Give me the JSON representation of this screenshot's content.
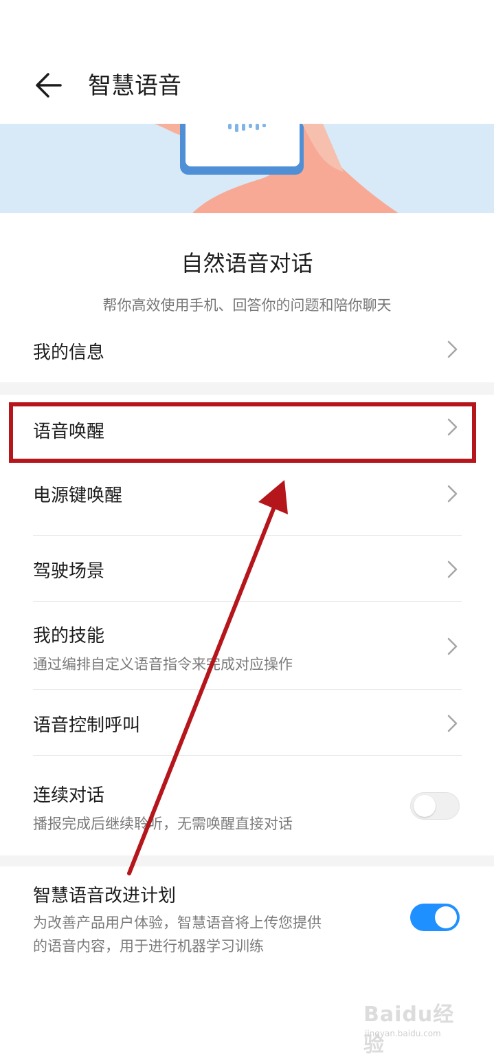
{
  "header": {
    "title": "智慧语音",
    "back_icon": "back-arrow-icon"
  },
  "intro": {
    "title": "自然语音对话",
    "subtitle": "帮你高效使用手机、回答你的问题和陪你聊天"
  },
  "settings": {
    "my_info": "我的信息",
    "voice_wakeup": "语音唤醒",
    "power_wakeup": "电源键唤醒",
    "driving": "驾驶场景",
    "my_skills": "我的技能",
    "my_skills_desc": "通过编排自定义语音指令来完成对应操作",
    "voice_call": "语音控制呼叫",
    "continuous": "连续对话",
    "continuous_desc": "播报完成后继续聆听，无需唤醒直接对话",
    "continuous_on": false,
    "improve": "智慧语音改进计划",
    "improve_desc_1": "为改善产品用户体验，智慧语音将上传您提供",
    "improve_desc_2": "的语音内容，用于进行机器学习训练",
    "improve_on": true
  },
  "watermark": {
    "text": "Baidu经验",
    "url": "jingyan.baidu.com"
  },
  "colors": {
    "accent": "#1e90ff",
    "annotation": "#b5161b",
    "banner": "#d8e9f7"
  }
}
